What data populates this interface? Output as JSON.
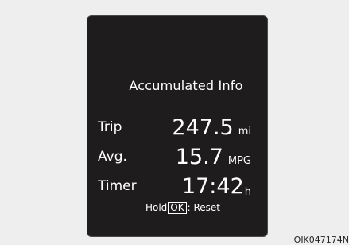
{
  "display": {
    "title": "Accumulated Info",
    "rows": [
      {
        "label": "Trip",
        "value": "247.5",
        "unit": "mi"
      },
      {
        "label": "Avg.",
        "value": "15.7",
        "unit": "MPG"
      },
      {
        "label": "Timer",
        "value": "17:42",
        "unit": "h"
      }
    ],
    "hint": {
      "prefix": "Hold",
      "key": "OK",
      "suffix": ": Reset"
    }
  },
  "figure_code": "OIK047174N",
  "colors": {
    "page_background": "#eeeeee",
    "panel_background": "#1e1c1d",
    "text": "#ffffff"
  }
}
